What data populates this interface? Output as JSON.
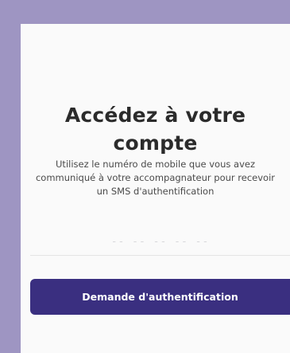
{
  "login": {
    "title": "Accédez à votre compte",
    "subtitle": "Utilisez le numéro de mobile que vous avez communiqué à votre accompagnateur pour recevoir un SMS d'authentification",
    "phone_placeholder": "-- -- -- -- --",
    "submit_label": "Demande d'authentification"
  },
  "colors": {
    "background": "#9e95c2",
    "card": "#fafafa",
    "primary_button": "#3a2f80",
    "title_text": "#2b2b2b"
  }
}
